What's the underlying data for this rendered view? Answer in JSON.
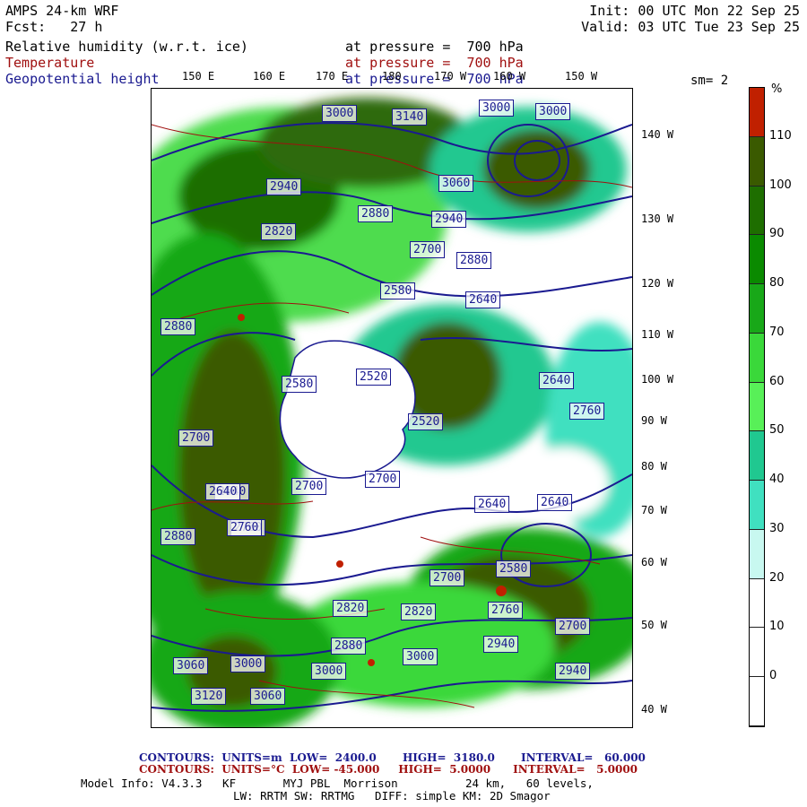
{
  "header": {
    "model": "AMPS 24-km WRF",
    "init": "Init: 00 UTC Mon 22 Sep 25",
    "fcst_label": "Fcst:",
    "fcst_value": "27 h",
    "valid": "Valid: 03 UTC Tue 23 Sep 25",
    "field1_name": "Relative humidity (w.r.t. ice)",
    "field1_level": "at pressure =  700 hPa",
    "field2_name": "Temperature",
    "field2_level": "at pressure =  700 hPa",
    "field3_name": "Geopotential height",
    "field3_level": "at pressure =  700 hPa",
    "smoothing": "sm= 2"
  },
  "lon_labels": [
    "150 E",
    "160 E",
    "170 E",
    "180",
    "170 W",
    "160 W",
    "150 W"
  ],
  "lat_labels": [
    "140 W",
    "130 W",
    "120 W",
    "110 W",
    "100 W",
    "90 W",
    "80 W",
    "70 W",
    "60 W",
    "50 W",
    "40 W"
  ],
  "colorbar": {
    "unit": "%",
    "labels": [
      "110",
      "100",
      "90",
      "80",
      "70",
      "60",
      "50",
      "40",
      "30",
      "20",
      "10",
      "0"
    ],
    "colors": [
      "#c02000",
      "#3a5a00",
      "#1e6e00",
      "#0a8a00",
      "#18a818",
      "#3ad83a",
      "#58f058",
      "#20c890",
      "#40e0c0",
      "#c8f8f0",
      "#ffffff",
      "#ffffff",
      "#ffffff"
    ]
  },
  "height_labels": [
    "3000",
    "3140",
    "3000",
    "3000",
    "2940",
    "2880",
    "2940",
    "2820",
    "3060",
    "2700",
    "2880",
    "2580",
    "2640",
    "2520",
    "2880",
    "2700",
    "2580",
    "2640",
    "2760",
    "2700",
    "2640",
    "2520",
    "2700",
    "2640",
    "2700",
    "2760",
    "2640",
    "2760",
    "2820",
    "2880",
    "2940",
    "3000",
    "3060",
    "3120",
    "3060",
    "3000",
    "2940",
    "2880",
    "2820",
    "2760",
    "2700",
    "2640",
    "2580",
    "3000"
  ],
  "footer": {
    "line1": "CONTOURS:  UNITS=m  LOW=  2400.0       HIGH=  3180.0       INTERVAL=   60.000",
    "line2": "CONTOURS:  UNITS=°C  LOW= -45.000     HIGH=  5.0000      INTERVAL=   5.0000",
    "info1": "Model Info: V4.3.3   KF       MYJ PBL  Morrison          24 km,   60 levels,",
    "info2": "LW: RRTM SW: RRTMG   DIFF: simple KM: 2D Smagor"
  },
  "colors": {
    "height": "#1a1a90",
    "temperature": "#a01010"
  }
}
